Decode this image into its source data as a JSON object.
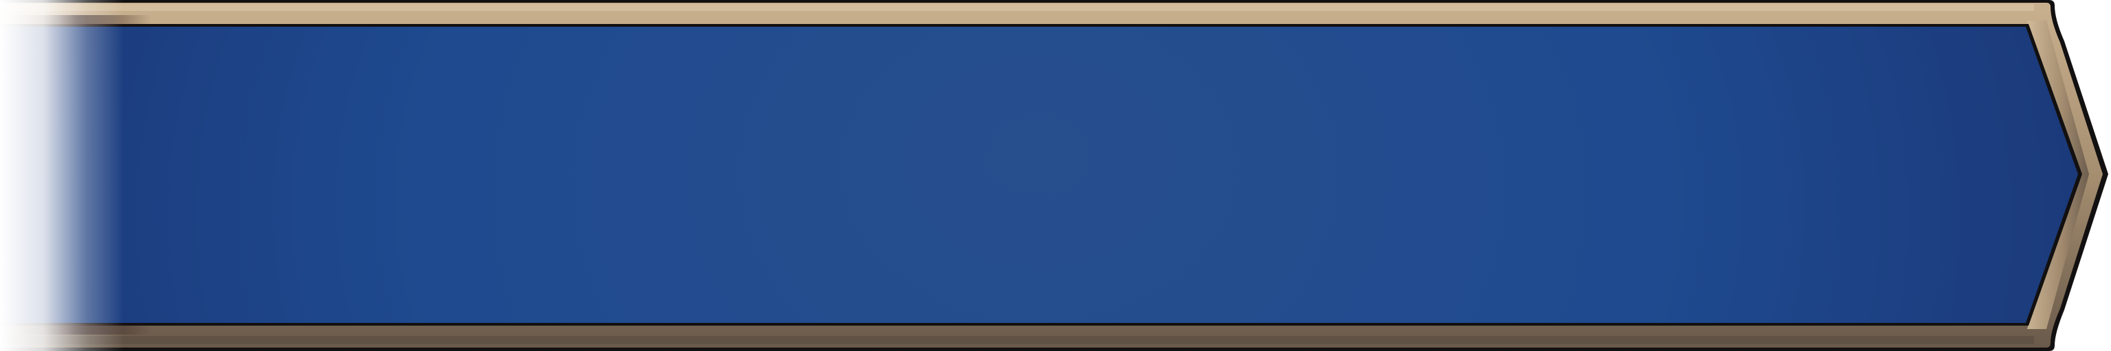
{
  "banner": {
    "shape": "right-pointing-arrow-banner",
    "colors": {
      "panel_edge": "#1a3676",
      "panel_mid": "#1f4a8f",
      "panel_center": "#274f8e",
      "border_light": "#c9b08e",
      "border_mid": "#a58e70",
      "border_dark": "#6a5a4b",
      "outline": "#121010",
      "fade_to": "#ffffff"
    }
  }
}
